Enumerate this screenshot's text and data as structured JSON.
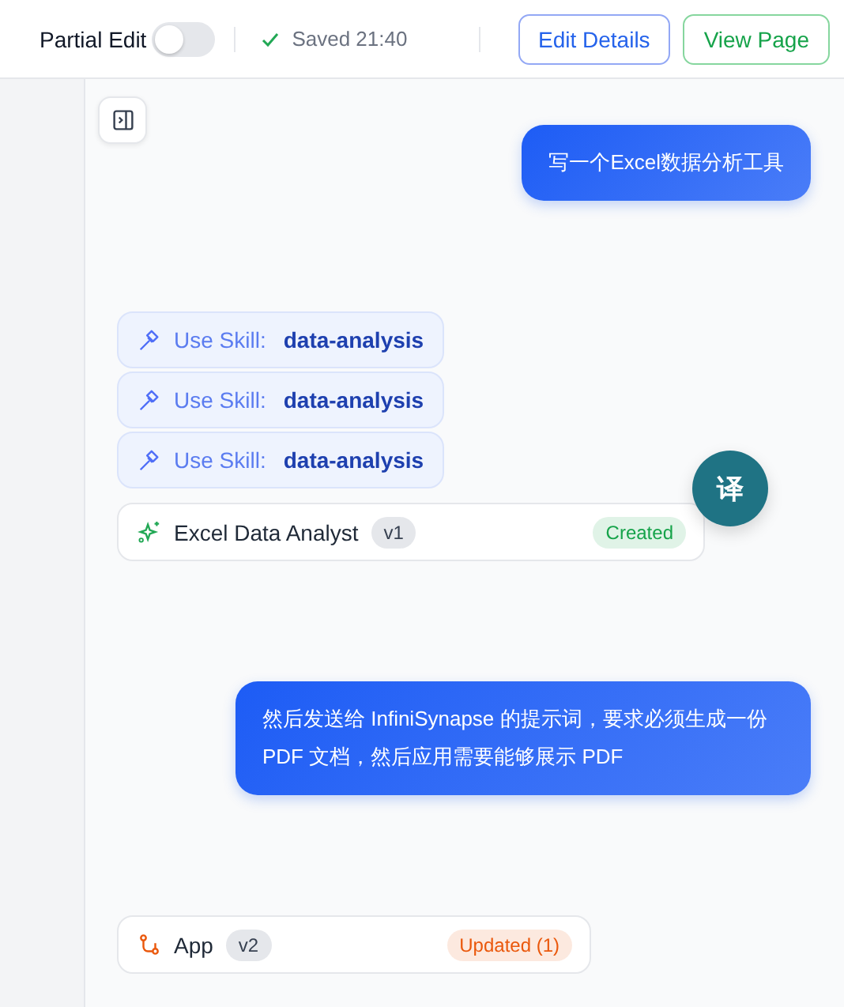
{
  "header": {
    "partial_edit": {
      "label": "Partial Edit",
      "on": false
    },
    "save_status": "Saved 21:40",
    "buttons": [
      {
        "label": "Edit Details",
        "kind": "primary"
      },
      {
        "label": "View Page",
        "kind": "success"
      }
    ]
  },
  "messages": [
    {
      "kind": "user",
      "text": "写一个Excel数据分析工具"
    },
    {
      "kind": "skill",
      "label": "Use Skill:",
      "value": "data-analysis"
    },
    {
      "kind": "skill",
      "label": "Use Skill:",
      "value": "data-analysis"
    },
    {
      "kind": "skill",
      "label": "Use Skill:",
      "value": "data-analysis"
    },
    {
      "kind": "agent",
      "name": "Excel Data Analyst",
      "version": "v1",
      "status": "Created",
      "color": "#16a34a"
    },
    {
      "kind": "user",
      "text": "然后发送给 InfiniSynapse 的提示词，要求必须生成一份PDF 文档，然后应用需要能够展示 PDF"
    },
    {
      "kind": "app",
      "name": "App",
      "version": "v2",
      "status": "Updated (1)",
      "color": "#ea580c"
    }
  ],
  "translate_button": "译"
}
